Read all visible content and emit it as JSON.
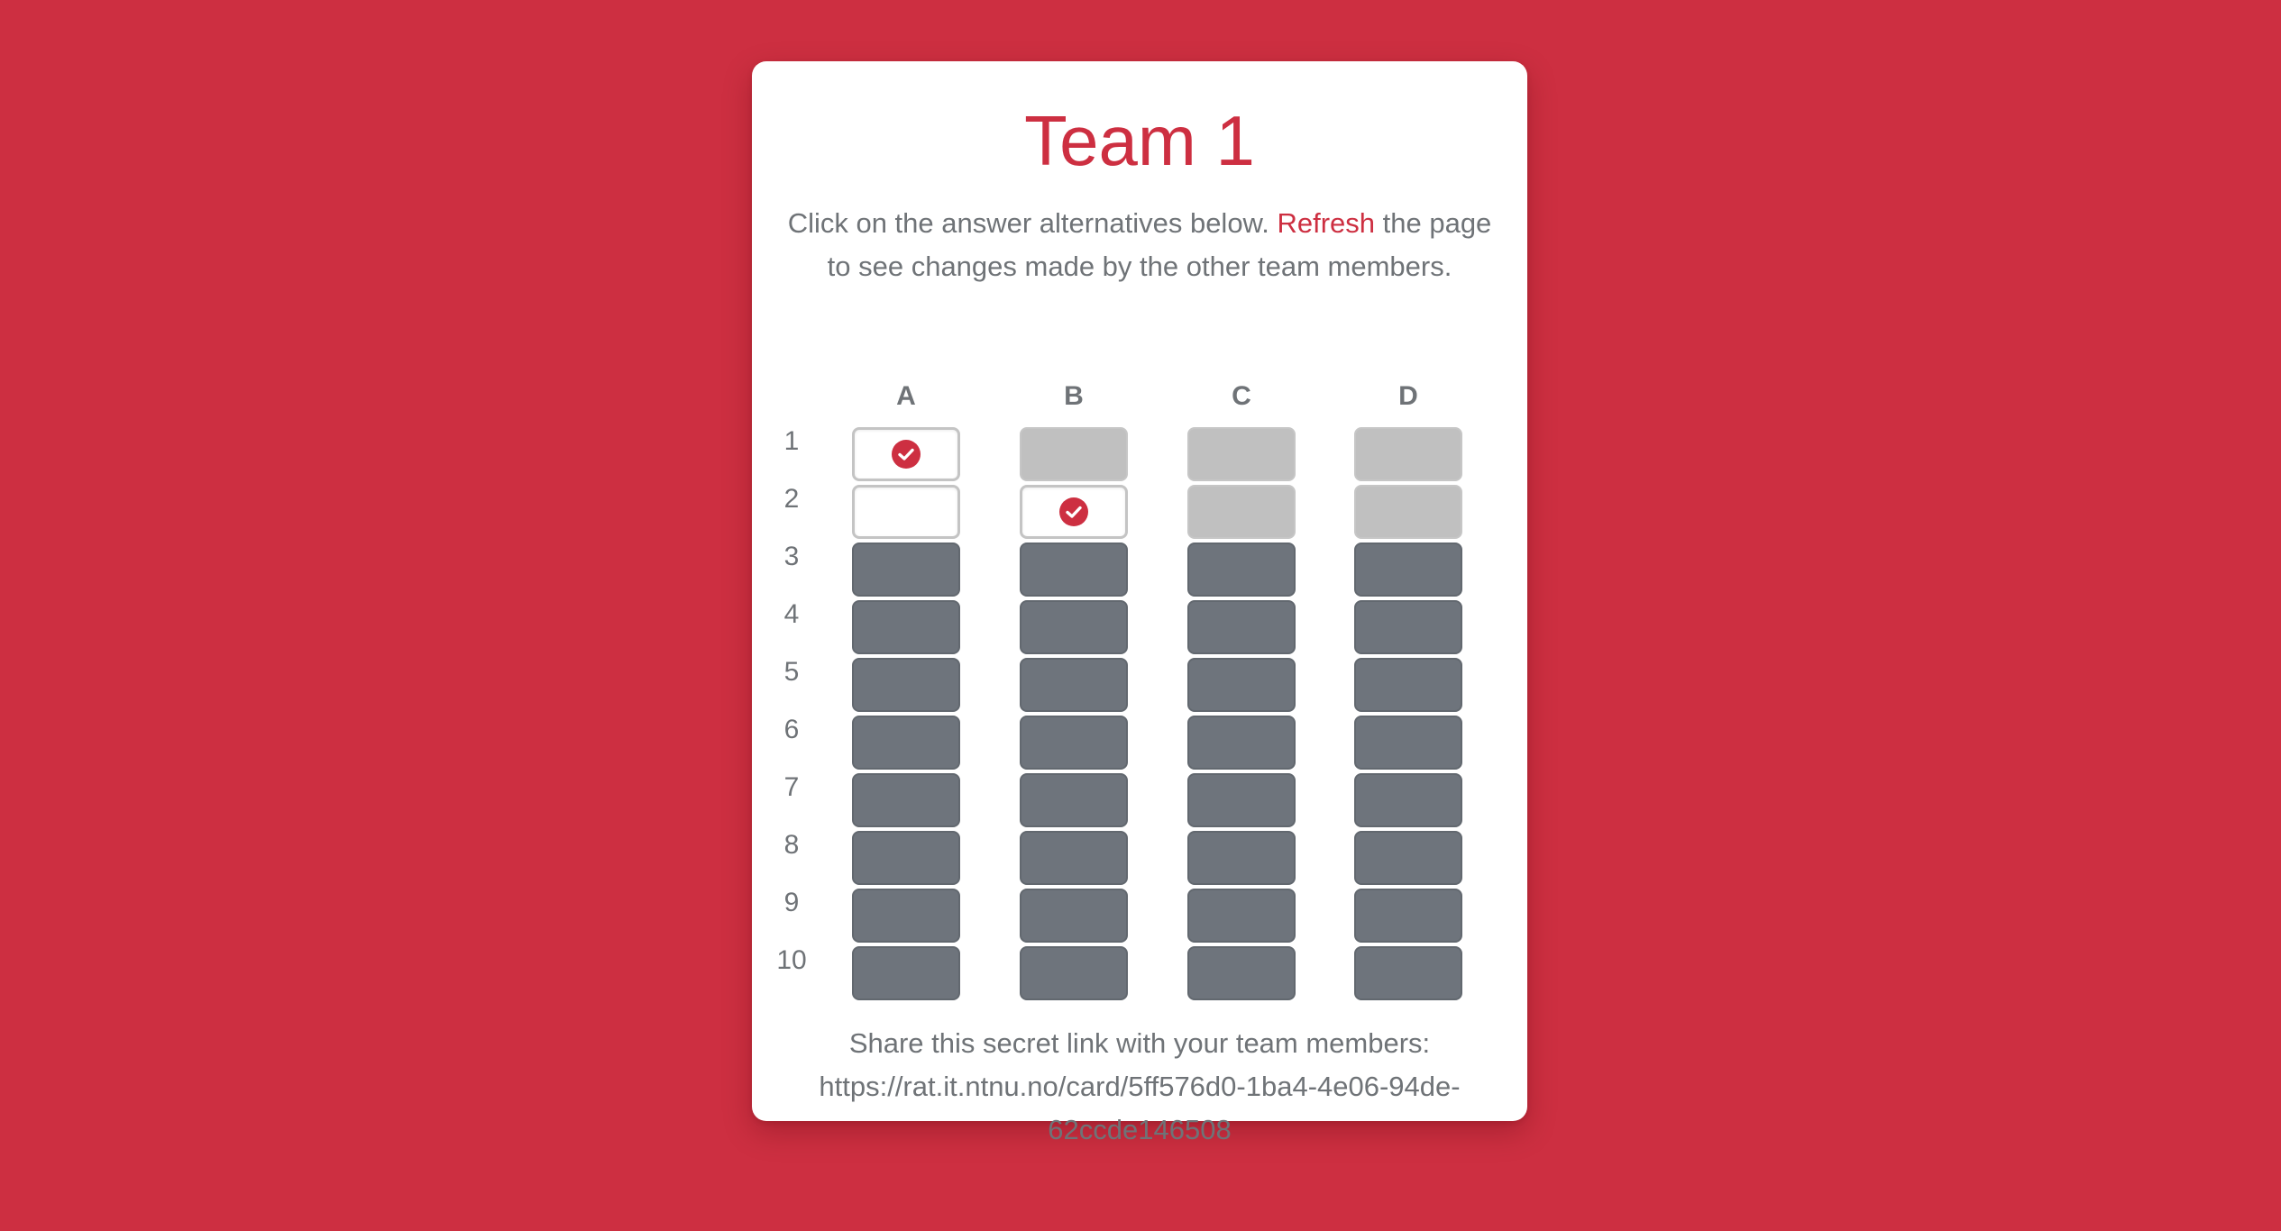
{
  "colors": {
    "background": "#cd2f41",
    "card": "#ffffff",
    "accent": "#cd2f41",
    "text": "#6f7377",
    "cell_open": "#ffffff",
    "cell_used": "#c0c0c0",
    "cell_locked": "#6e747c"
  },
  "card": {
    "title": "Team 1",
    "instructions": {
      "before": "Click on the answer alternatives below. ",
      "link": "Refresh",
      "after": " the page to see changes made by the other team members."
    }
  },
  "grid": {
    "columns": [
      "A",
      "B",
      "C",
      "D"
    ],
    "rows": [
      {
        "label": "1",
        "cells": [
          {
            "state": "open",
            "checked": true
          },
          {
            "state": "used",
            "checked": false
          },
          {
            "state": "used",
            "checked": false
          },
          {
            "state": "used",
            "checked": false
          }
        ]
      },
      {
        "label": "2",
        "cells": [
          {
            "state": "open",
            "checked": false
          },
          {
            "state": "open",
            "checked": true
          },
          {
            "state": "used",
            "checked": false
          },
          {
            "state": "used",
            "checked": false
          }
        ]
      },
      {
        "label": "3",
        "cells": [
          {
            "state": "locked",
            "checked": false
          },
          {
            "state": "locked",
            "checked": false
          },
          {
            "state": "locked",
            "checked": false
          },
          {
            "state": "locked",
            "checked": false
          }
        ]
      },
      {
        "label": "4",
        "cells": [
          {
            "state": "locked",
            "checked": false
          },
          {
            "state": "locked",
            "checked": false
          },
          {
            "state": "locked",
            "checked": false
          },
          {
            "state": "locked",
            "checked": false
          }
        ]
      },
      {
        "label": "5",
        "cells": [
          {
            "state": "locked",
            "checked": false
          },
          {
            "state": "locked",
            "checked": false
          },
          {
            "state": "locked",
            "checked": false
          },
          {
            "state": "locked",
            "checked": false
          }
        ]
      },
      {
        "label": "6",
        "cells": [
          {
            "state": "locked",
            "checked": false
          },
          {
            "state": "locked",
            "checked": false
          },
          {
            "state": "locked",
            "checked": false
          },
          {
            "state": "locked",
            "checked": false
          }
        ]
      },
      {
        "label": "7",
        "cells": [
          {
            "state": "locked",
            "checked": false
          },
          {
            "state": "locked",
            "checked": false
          },
          {
            "state": "locked",
            "checked": false
          },
          {
            "state": "locked",
            "checked": false
          }
        ]
      },
      {
        "label": "8",
        "cells": [
          {
            "state": "locked",
            "checked": false
          },
          {
            "state": "locked",
            "checked": false
          },
          {
            "state": "locked",
            "checked": false
          },
          {
            "state": "locked",
            "checked": false
          }
        ]
      },
      {
        "label": "9",
        "cells": [
          {
            "state": "locked",
            "checked": false
          },
          {
            "state": "locked",
            "checked": false
          },
          {
            "state": "locked",
            "checked": false
          },
          {
            "state": "locked",
            "checked": false
          }
        ]
      },
      {
        "label": "10",
        "cells": [
          {
            "state": "locked",
            "checked": false
          },
          {
            "state": "locked",
            "checked": false
          },
          {
            "state": "locked",
            "checked": false
          },
          {
            "state": "locked",
            "checked": false
          }
        ]
      }
    ],
    "check_icon": "check-circle-icon"
  },
  "share": {
    "label": "Share this secret link with your team members:",
    "url": "https://rat.it.ntnu.no/card/5ff576d0-1ba4-4e06-94de-62ccde146508"
  }
}
